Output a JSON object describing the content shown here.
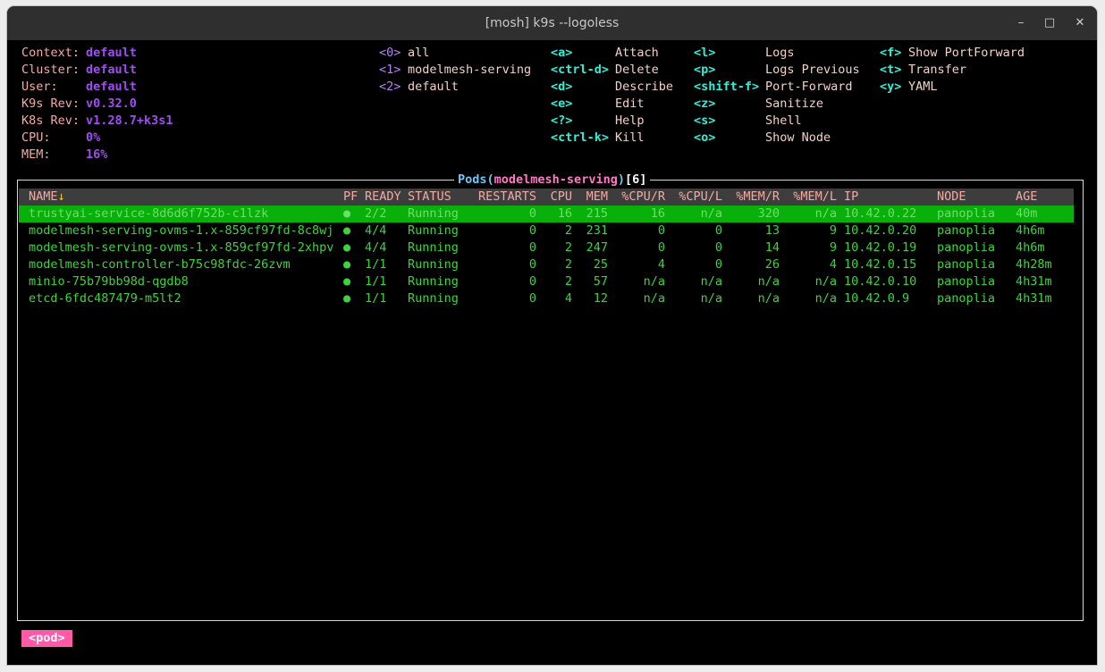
{
  "window": {
    "title": "[mosh] k9s --logoless",
    "buttons": {
      "minimize": "–",
      "maximize": "□",
      "close": "✕"
    }
  },
  "info": [
    {
      "label": "Context:",
      "value": "default"
    },
    {
      "label": "Cluster:",
      "value": "default"
    },
    {
      "label": "User:",
      "value": "default"
    },
    {
      "label": "K9s Rev:",
      "value": "v0.32.0"
    },
    {
      "label": "K8s Rev:",
      "value": "v1.28.7+k3s1"
    },
    {
      "label": "CPU:",
      "value": "0%"
    },
    {
      "label": "MEM:",
      "value": "16%"
    }
  ],
  "namespaces": [
    {
      "key": "<0>",
      "name": "all"
    },
    {
      "key": "<1>",
      "name": "modelmesh-serving"
    },
    {
      "key": "<2>",
      "name": "default"
    }
  ],
  "hints": [
    [
      {
        "key": "<a>",
        "label": "Attach"
      },
      {
        "key": "<ctrl-d>",
        "label": "Delete"
      },
      {
        "key": "<d>",
        "label": "Describe"
      },
      {
        "key": "<e>",
        "label": "Edit"
      },
      {
        "key": "<?>",
        "label": "Help"
      },
      {
        "key": "<ctrl-k>",
        "label": "Kill"
      }
    ],
    [
      {
        "key": "<l>",
        "label": "Logs"
      },
      {
        "key": "<p>",
        "label": "Logs Previous"
      },
      {
        "key": "<shift-f>",
        "label": "Port-Forward"
      },
      {
        "key": "<z>",
        "label": "Sanitize"
      },
      {
        "key": "<s>",
        "label": "Shell"
      },
      {
        "key": "<o>",
        "label": "Show Node"
      }
    ],
    [
      {
        "key": "<f>",
        "label": "Show PortForward"
      },
      {
        "key": "<t>",
        "label": "Transfer"
      },
      {
        "key": "<y>",
        "label": "YAML"
      }
    ]
  ],
  "table": {
    "title_resource": "Pods",
    "title_paren_open": "(",
    "title_namespace": "modelmesh-serving",
    "title_paren_close": ")",
    "title_count": "[6]",
    "sort_arrow": "↓",
    "headers": {
      "name": "NAME",
      "pf": "PF",
      "ready": "READY",
      "status": "STATUS",
      "restarts": "RESTARTS",
      "cpu": "CPU",
      "mem": "MEM",
      "cpu_r": "%CPU/R",
      "cpu_l": "%CPU/L",
      "mem_r": "%MEM/R",
      "mem_l": "%MEM/L",
      "ip": "IP",
      "node": "NODE",
      "age": "AGE"
    },
    "rows": [
      {
        "name": "trustyai-service-8d6d6f752b-c1lzk",
        "pf": "●",
        "ready": "2/2",
        "status": "Running",
        "restarts": "0",
        "cpu": "16",
        "mem": "215",
        "cpu_r": "16",
        "cpu_l": "n/a",
        "mem_r": "320",
        "mem_l": "n/a",
        "ip": "10.42.0.22",
        "node": "panoplia",
        "age": "40m"
      },
      {
        "name": "modelmesh-serving-ovms-1.x-859cf97fd-8c8wj",
        "pf": "●",
        "ready": "4/4",
        "status": "Running",
        "restarts": "0",
        "cpu": "2",
        "mem": "231",
        "cpu_r": "0",
        "cpu_l": "0",
        "mem_r": "13",
        "mem_l": "9",
        "ip": "10.42.0.20",
        "node": "panoplia",
        "age": "4h6m"
      },
      {
        "name": "modelmesh-serving-ovms-1.x-859cf97fd-2xhpv",
        "pf": "●",
        "ready": "4/4",
        "status": "Running",
        "restarts": "0",
        "cpu": "2",
        "mem": "247",
        "cpu_r": "0",
        "cpu_l": "0",
        "mem_r": "14",
        "mem_l": "9",
        "ip": "10.42.0.19",
        "node": "panoplia",
        "age": "4h6m"
      },
      {
        "name": "modelmesh-controller-b75c98fdc-26zvm",
        "pf": "●",
        "ready": "1/1",
        "status": "Running",
        "restarts": "0",
        "cpu": "2",
        "mem": "25",
        "cpu_r": "4",
        "cpu_l": "0",
        "mem_r": "26",
        "mem_l": "4",
        "ip": "10.42.0.15",
        "node": "panoplia",
        "age": "4h28m"
      },
      {
        "name": "minio-75b79bb98d-qgdb8",
        "pf": "●",
        "ready": "1/1",
        "status": "Running",
        "restarts": "0",
        "cpu": "2",
        "mem": "57",
        "cpu_r": "n/a",
        "cpu_l": "n/a",
        "mem_r": "n/a",
        "mem_l": "n/a",
        "ip": "10.42.0.10",
        "node": "panoplia",
        "age": "4h31m"
      },
      {
        "name": "etcd-6fdc487479-m5lt2",
        "pf": "●",
        "ready": "1/1",
        "status": "Running",
        "restarts": "0",
        "cpu": "4",
        "mem": "12",
        "cpu_r": "n/a",
        "cpu_l": "n/a",
        "mem_r": "n/a",
        "mem_l": "n/a",
        "ip": "10.42.0.9",
        "node": "panoplia",
        "age": "4h31m"
      }
    ]
  },
  "breadcrumb": "<pod>",
  "colors": {
    "terminal_bg": "#000000",
    "selected_row_bg": "#0ab00a",
    "row_text": "#3bd53b",
    "header_text": "#f5a9a3",
    "hint_key": "#2ef0d8",
    "info_value": "#a04df0",
    "breadcrumb_bg": "#ff59a8"
  }
}
